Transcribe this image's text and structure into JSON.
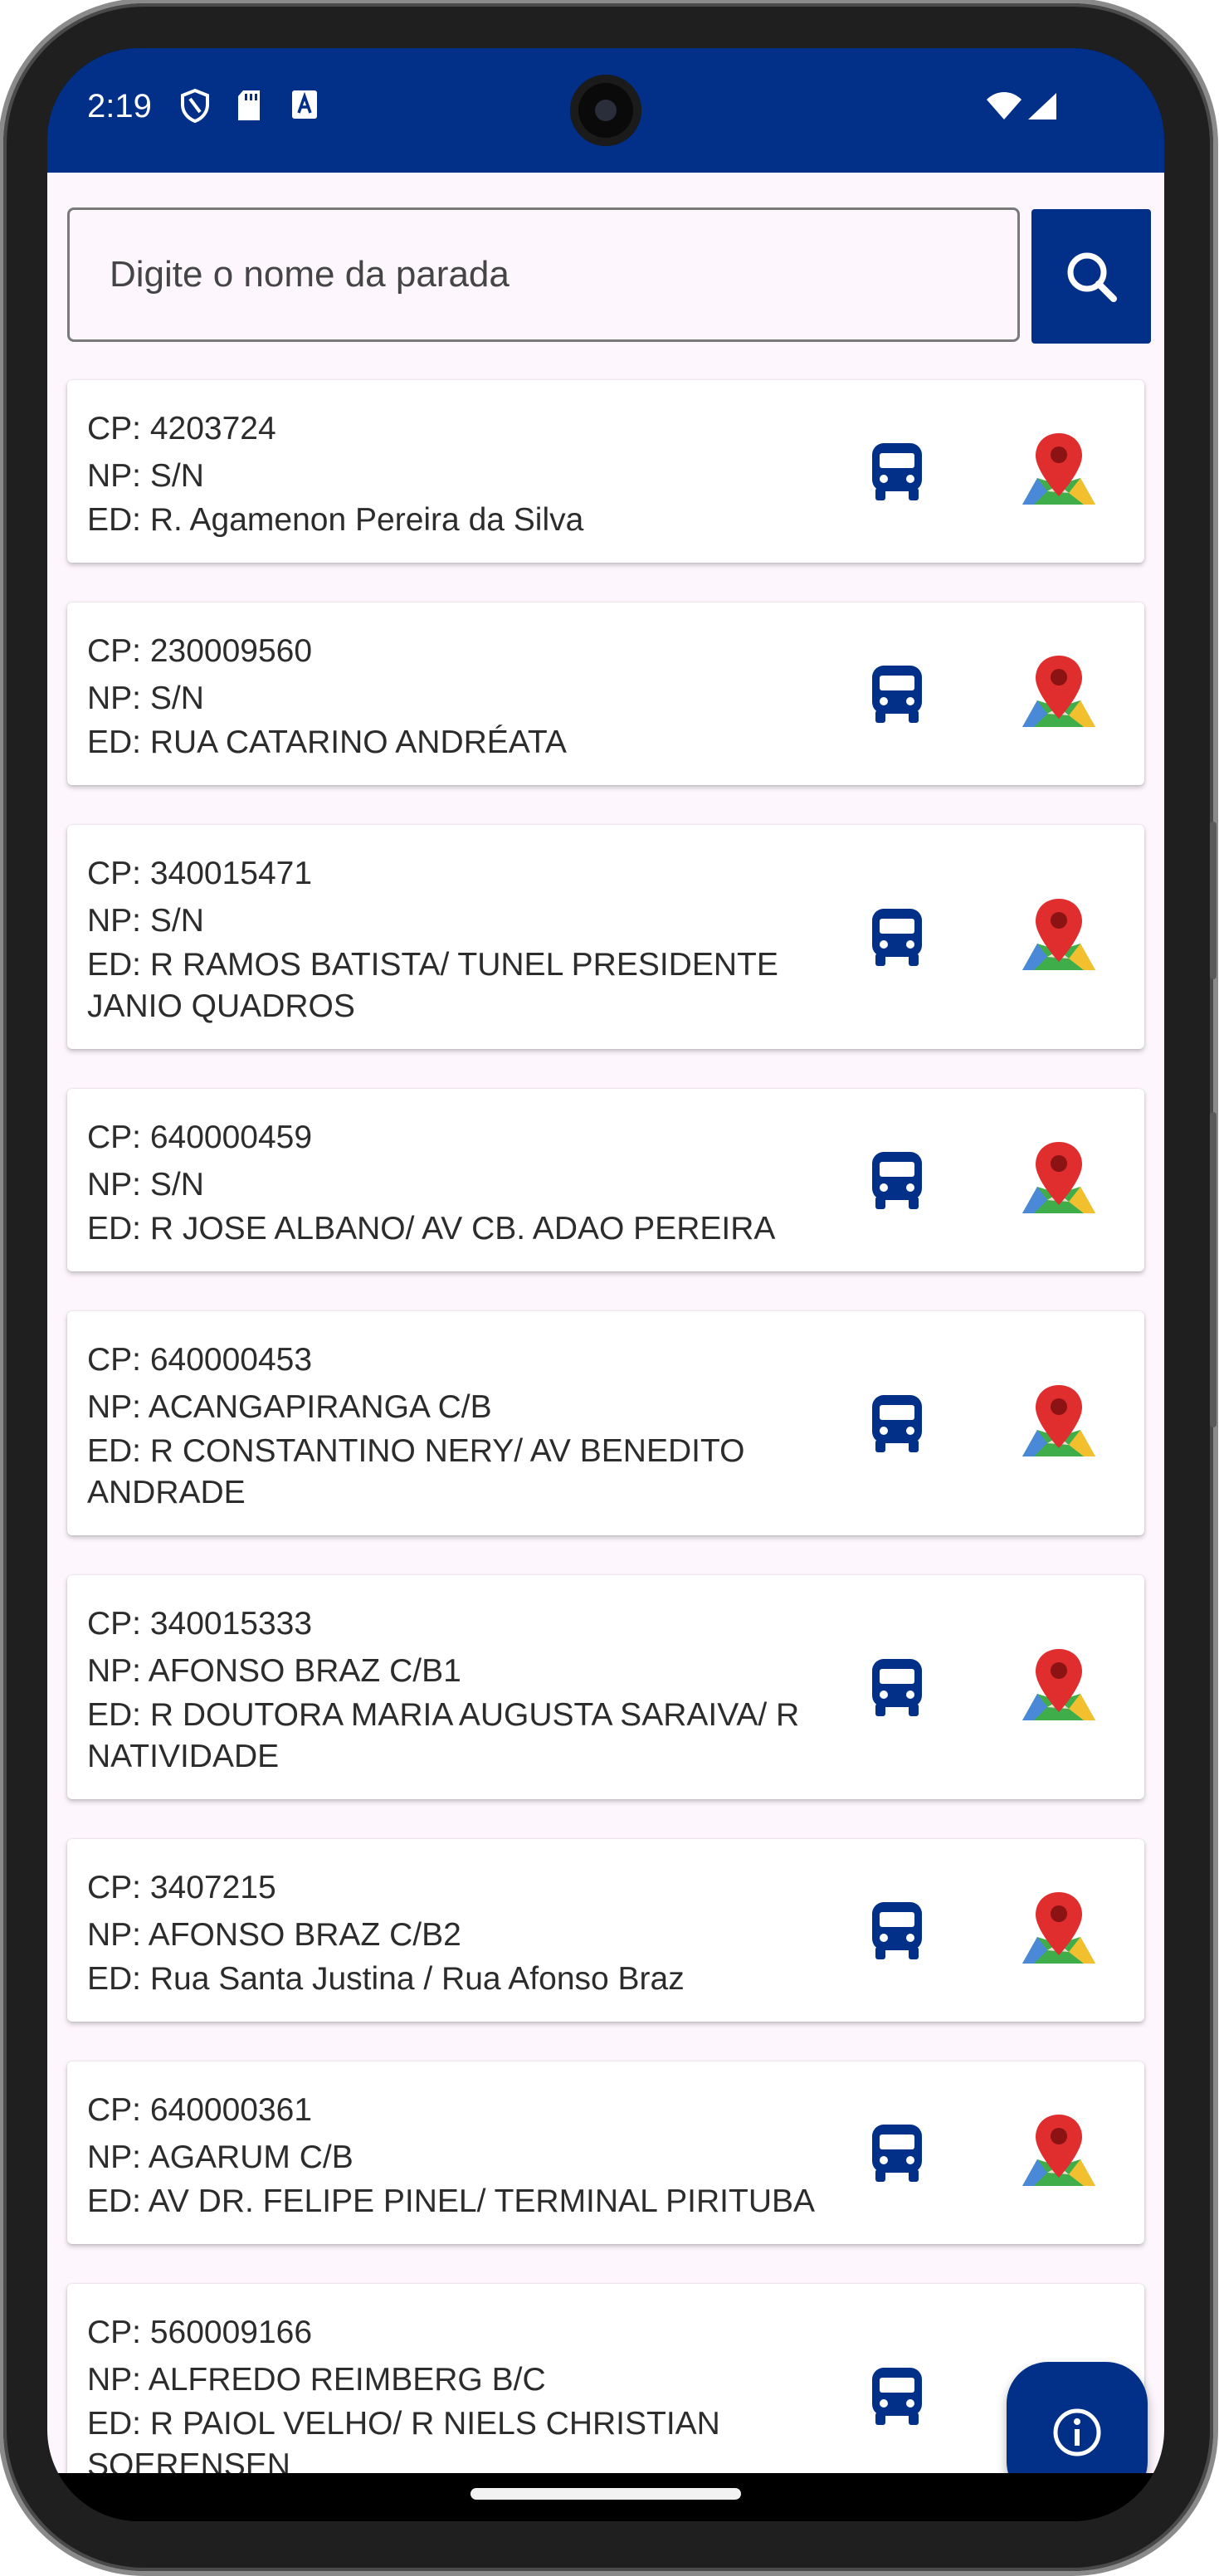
{
  "status_bar": {
    "time": "2:19"
  },
  "search": {
    "placeholder": "Digite o nome da parada"
  },
  "colors": {
    "primary": "#023089",
    "background": "#fdf6fc",
    "map_pin": "#e02d2d"
  },
  "icons": {
    "bus": "bus-icon",
    "map": "map-pin-icon",
    "search": "search-icon",
    "info": "info-icon"
  },
  "stops": [
    {
      "cp": "CP: 4203724",
      "np": "NP: S/N",
      "ed": "ED: R. Agamenon Pereira da Silva"
    },
    {
      "cp": "CP: 230009560",
      "np": "NP: S/N",
      "ed": "ED: RUA CATARINO ANDRÉATA"
    },
    {
      "cp": "CP: 340015471",
      "np": "NP: S/N",
      "ed": "ED: R RAMOS BATISTA/ TUNEL PRESIDENTE JANIO QUADROS"
    },
    {
      "cp": "CP: 640000459",
      "np": "NP: S/N",
      "ed": "ED: R JOSE ALBANO/ AV CB. ADAO PEREIRA"
    },
    {
      "cp": "CP: 640000453",
      "np": "NP: ACANGAPIRANGA C/B",
      "ed": "ED: R CONSTANTINO NERY/ AV BENEDITO ANDRADE"
    },
    {
      "cp": "CP: 340015333",
      "np": "NP: AFONSO BRAZ C/B1",
      "ed": "ED: R DOUTORA MARIA AUGUSTA SARAIVA/ R NATIVIDADE"
    },
    {
      "cp": "CP: 3407215",
      "np": "NP: AFONSO BRAZ C/B2",
      "ed": "ED: Rua Santa Justina / Rua Afonso Braz"
    },
    {
      "cp": "CP: 640000361",
      "np": "NP: AGARUM C/B",
      "ed": "ED: AV DR. FELIPE PINEL/ TERMINAL PIRITUBA"
    },
    {
      "cp": "CP: 560009166",
      "np": "NP: ALFREDO REIMBERG B/C",
      "ed": "ED: R PAIOL VELHO/ R NIELS CHRISTIAN SOERENSEN"
    }
  ]
}
